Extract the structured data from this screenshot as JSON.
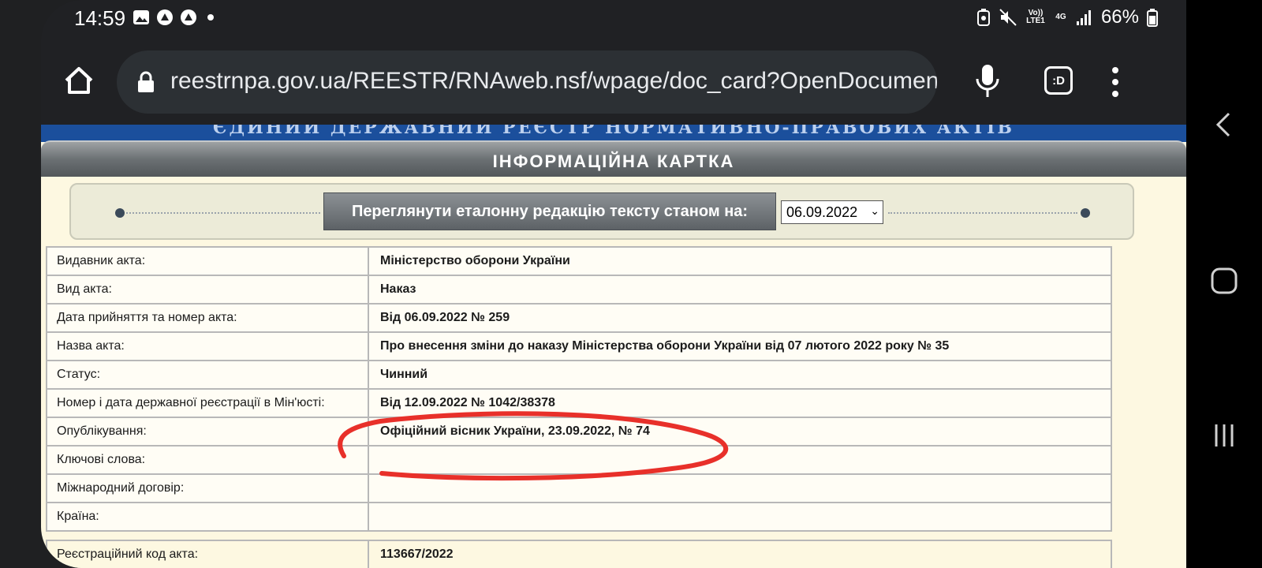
{
  "status_bar": {
    "time": "14:59",
    "volte_label": "Vo)) LTE1",
    "network_label": "4G",
    "battery_percent": "66%"
  },
  "browser": {
    "url": "reestrnpa.gov.ua/REESTR/RNAweb.nsf/wpage/doc_card?OpenDocument",
    "tabs_label": ":D"
  },
  "page": {
    "banner": "ЄДИНИЙ ДЕРЖАВНИЙ РЕЄСТР НОРМАТИВНО-ПРАВОВИХ АКТІВ",
    "card_title": "ІНФОРМАЦІЙНА КАРТКА",
    "view_button_label": "Переглянути еталонну редакцію тексту станом на:",
    "date_select_value": "06.09.2022",
    "rows": [
      {
        "label": "Видавник акта:",
        "value": "Міністерство оборони України"
      },
      {
        "label": "Вид акта:",
        "value": "Наказ"
      },
      {
        "label": "Дата прийняття та номер акта:",
        "value": "Від 06.09.2022 № 259"
      },
      {
        "label": "Назва акта:",
        "value": "Про внесення зміни до наказу Міністерства оборони України від 07 лютого 2022 року № 35"
      },
      {
        "label": "Статус:",
        "value": "Чинний"
      },
      {
        "label": "Номер і дата державної реєстрації в Мін'юсті:",
        "value": "Від 12.09.2022 № 1042/38378"
      },
      {
        "label": "Опублікування:",
        "value": "Офіційний вісник України, 23.09.2022, № 74"
      },
      {
        "label": "Ключові слова:",
        "value": ""
      },
      {
        "label": "Міжнародний договір:",
        "value": ""
      },
      {
        "label": "Країна:",
        "value": ""
      }
    ],
    "registration": {
      "label": "Реєстраційний код акта:",
      "value": "113667/2022"
    }
  },
  "colors": {
    "annotation_red": "#e8302a",
    "page_background": "#fdf8e1",
    "banner_blue": "#1b4f9c"
  }
}
